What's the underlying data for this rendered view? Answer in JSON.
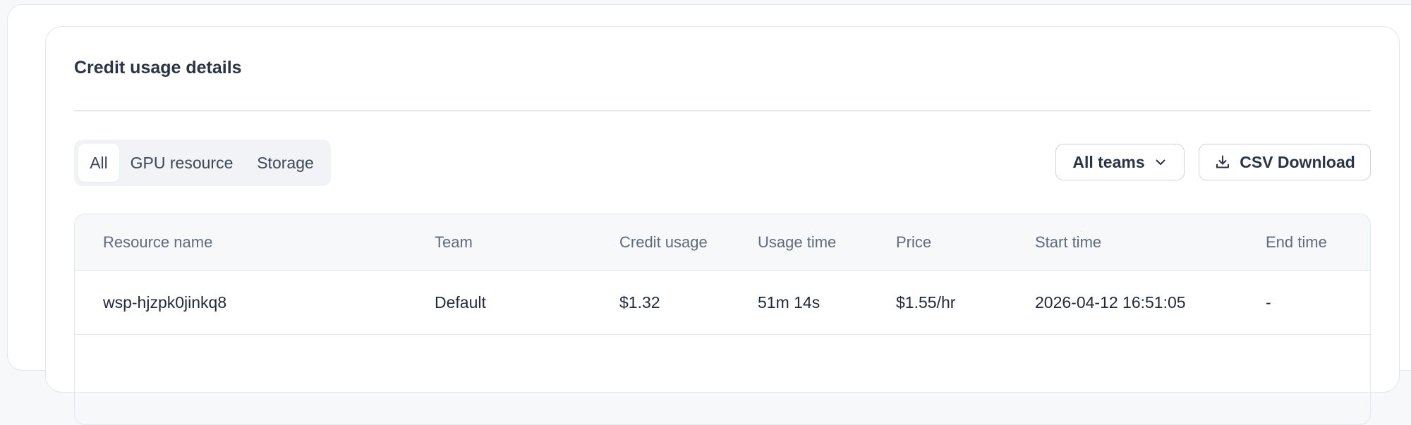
{
  "section": {
    "title": "Credit usage details"
  },
  "filters": {
    "tabs": [
      {
        "label": "All",
        "active": true
      },
      {
        "label": "GPU resource",
        "active": false
      },
      {
        "label": "Storage",
        "active": false
      }
    ]
  },
  "actions": {
    "team_select_label": "All teams",
    "csv_label": "CSV Download"
  },
  "table": {
    "columns": [
      "Resource name",
      "Team",
      "Credit usage",
      "Usage time",
      "Price",
      "Start time",
      "End time"
    ],
    "rows": [
      {
        "resource_name": "wsp-hjzpk0jinkq8",
        "team": "Default",
        "credit_usage": "$1.32",
        "usage_time": "51m 14s",
        "price": "$1.55/hr",
        "start_time": "2026-04-12 16:51:05",
        "end_time": "-"
      }
    ]
  },
  "icons": {
    "dropdown": "chevron-down-icon",
    "download": "download-icon"
  }
}
